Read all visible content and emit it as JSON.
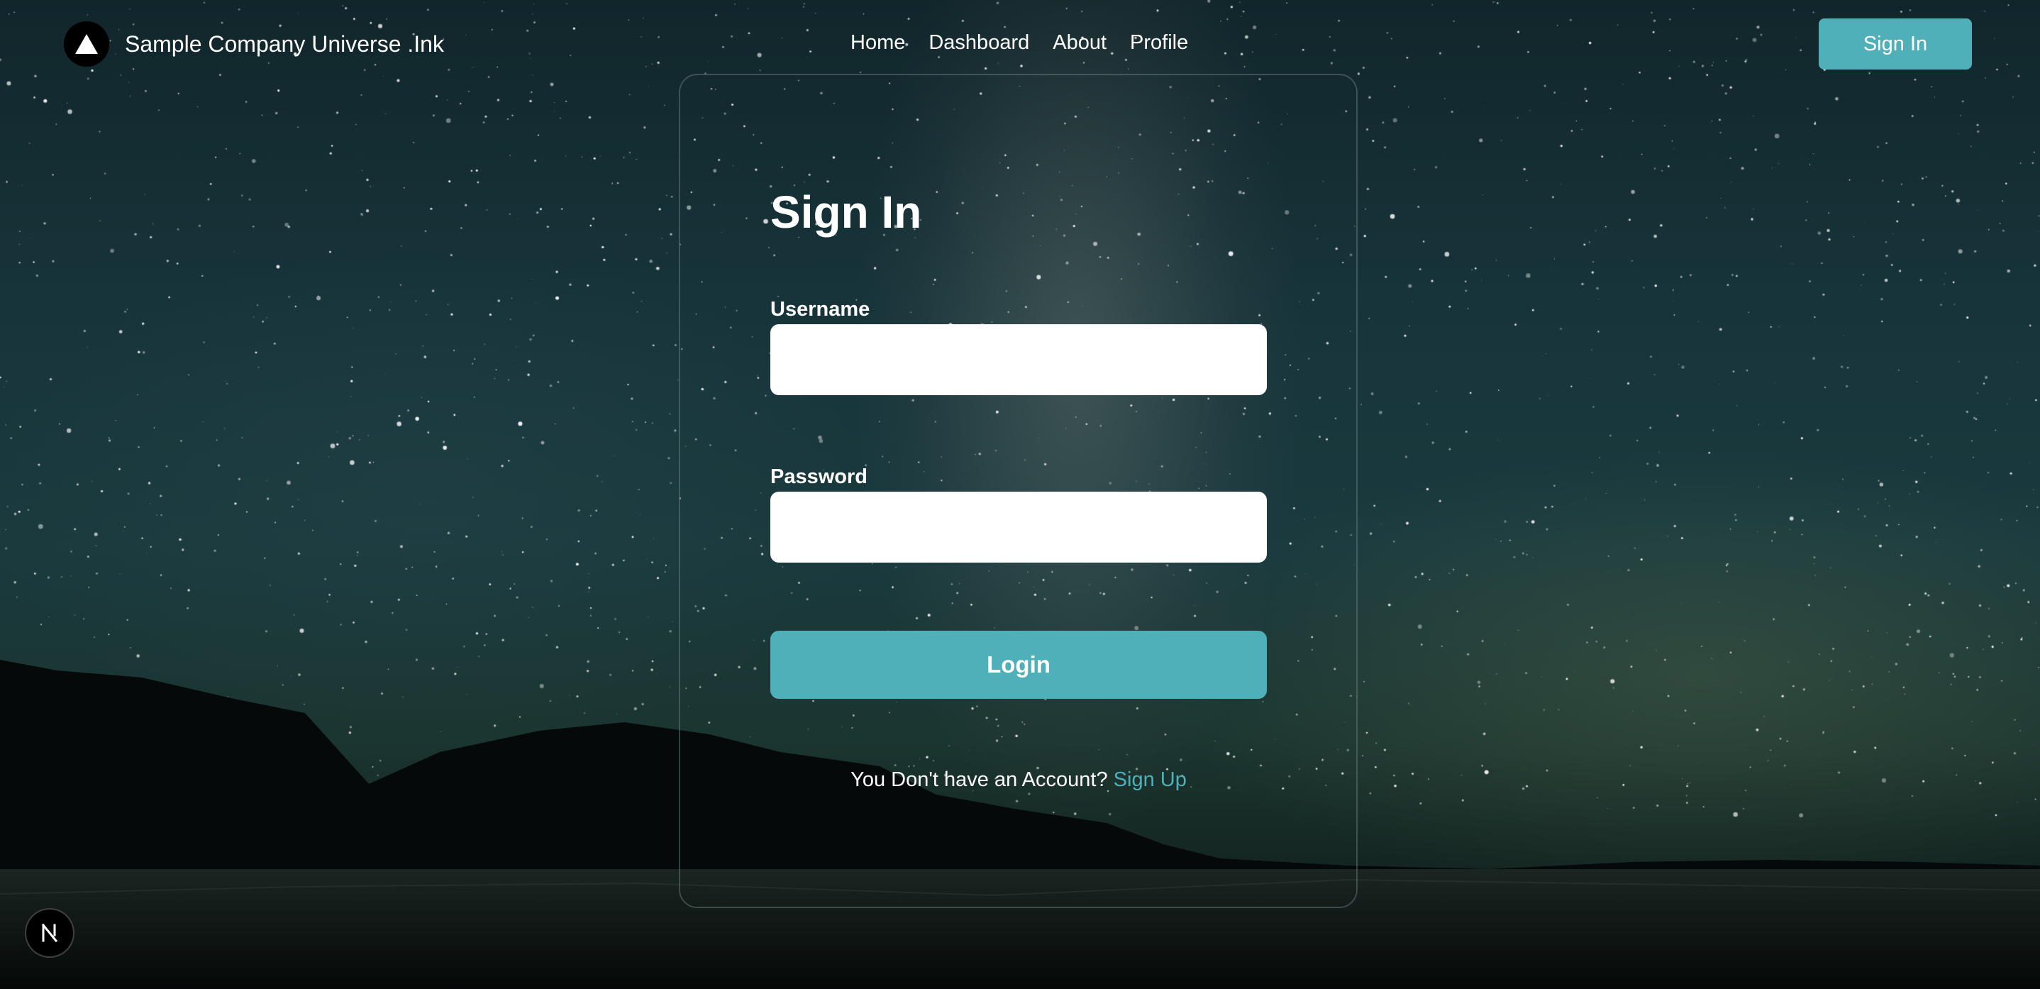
{
  "nav": {
    "brand_name": "Sample Company Universe .Ink",
    "links": [
      {
        "label": "Home"
      },
      {
        "label": "Dashboard"
      },
      {
        "label": "About"
      },
      {
        "label": "Profile"
      }
    ],
    "sign_in_label": "Sign In"
  },
  "form": {
    "title": "Sign In",
    "username_label": "Username",
    "username_value": "",
    "password_label": "Password",
    "password_value": "",
    "login_label": "Login",
    "signup_prompt": "You Don't have an Account?",
    "signup_link": "Sign Up"
  },
  "icons": {
    "logo": "triangle-logo-icon",
    "dev_badge": "nextjs-n-icon"
  },
  "colors": {
    "accent": "#4fb0ba",
    "text": "#ffffff",
    "input_bg": "#ffffff",
    "logo_bg": "#000000"
  }
}
